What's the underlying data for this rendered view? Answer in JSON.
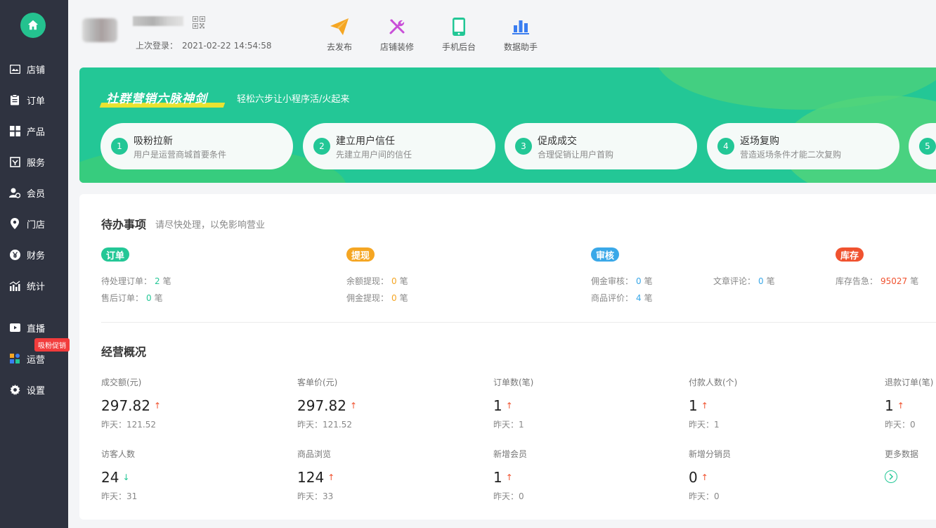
{
  "sidebar": {
    "items": [
      {
        "label": "店铺",
        "icon": "store-icon"
      },
      {
        "label": "订单",
        "icon": "clipboard-icon"
      },
      {
        "label": "产品",
        "icon": "grid-icon"
      },
      {
        "label": "服务",
        "icon": "service-icon"
      },
      {
        "label": "会员",
        "icon": "member-icon"
      },
      {
        "label": "门店",
        "icon": "location-pin-icon"
      },
      {
        "label": "财务",
        "icon": "yen-icon"
      },
      {
        "label": "统计",
        "icon": "stats-icon"
      },
      {
        "label": "直播",
        "icon": "video-icon"
      },
      {
        "label": "运营",
        "icon": "operations-icon"
      },
      {
        "label": "设置",
        "icon": "gear-icon"
      }
    ],
    "promo_badge": "吸粉促销"
  },
  "header": {
    "last_login_label": "上次登录：",
    "last_login_time": "2021-02-22 14:54:58",
    "shortcuts": [
      {
        "label": "去发布",
        "icon": "paper-plane-icon",
        "color": "#f5a623"
      },
      {
        "label": "店铺装修",
        "icon": "tools-icon",
        "color": "#c94fd8"
      },
      {
        "label": "手机后台",
        "icon": "phone-icon",
        "color": "#23c796"
      },
      {
        "label": "数据助手",
        "icon": "bar-chart-icon",
        "color": "#3a7df0"
      }
    ]
  },
  "banner": {
    "title": "社群营销六脉神剑",
    "subtitle": "轻松六步让小程序活/火起来",
    "steps": [
      {
        "num": "1",
        "title": "吸粉拉新",
        "desc": "用户是运营商城首要条件"
      },
      {
        "num": "2",
        "title": "建立用户信任",
        "desc": "先建立用户间的信任"
      },
      {
        "num": "3",
        "title": "促成成交",
        "desc": "合理促销让用户首购"
      },
      {
        "num": "4",
        "title": "返场复购",
        "desc": "营造返场条件才能二次复购"
      },
      {
        "num": "5",
        "title": "",
        "desc": ""
      }
    ]
  },
  "todo": {
    "title": "待办事项",
    "subtitle": "请尽快处理，以免影响营业",
    "groups": {
      "order": {
        "tag": "订单",
        "color": "#23c796",
        "items": [
          {
            "label": "待处理订单：",
            "value": "2",
            "unit": "笔"
          },
          {
            "label": "售后订单：",
            "value": "0",
            "unit": "笔"
          }
        ]
      },
      "withdraw": {
        "tag": "提现",
        "color": "#f5a623",
        "items": [
          {
            "label": "余额提现：",
            "value": "0",
            "unit": "笔"
          },
          {
            "label": "佣金提现：",
            "value": "0",
            "unit": "笔"
          }
        ]
      },
      "review": {
        "tag": "审核",
        "color": "#3aa8e8",
        "items": [
          {
            "label": "佣金审核：",
            "value": "0",
            "unit": "笔"
          },
          {
            "label": "商品评价：",
            "value": "4",
            "unit": "笔"
          },
          {
            "label": "文章评论：",
            "value": "0",
            "unit": "笔"
          }
        ]
      },
      "stock": {
        "tag": "库存",
        "color": "#f0522f",
        "items": [
          {
            "label": "库存告急：",
            "value": "95027",
            "unit": "笔"
          }
        ]
      }
    }
  },
  "overview": {
    "title": "经营概况",
    "prev_label": "昨天：",
    "metrics": [
      {
        "label": "成交额(元)",
        "value": "297.82",
        "trend": "↑",
        "prev": "121.52"
      },
      {
        "label": "客单价(元)",
        "value": "297.82",
        "trend": "↑",
        "prev": "121.52"
      },
      {
        "label": "订单数(笔)",
        "value": "1",
        "trend": "↑",
        "prev": "1"
      },
      {
        "label": "付款人数(个)",
        "value": "1",
        "trend": "↑",
        "prev": "1"
      },
      {
        "label": "退款订单(笔)",
        "value": "1",
        "trend": "↑",
        "prev": "0"
      },
      {
        "label": "访客人数",
        "value": "24",
        "trend": "↓",
        "prev": "31"
      },
      {
        "label": "商品浏览",
        "value": "124",
        "trend": "↑",
        "prev": "33"
      },
      {
        "label": "新增会员",
        "value": "1",
        "trend": "↑",
        "prev": "0"
      },
      {
        "label": "新增分销员",
        "value": "0",
        "trend": "↑",
        "prev": "0"
      }
    ],
    "more_label": "更多数据"
  }
}
